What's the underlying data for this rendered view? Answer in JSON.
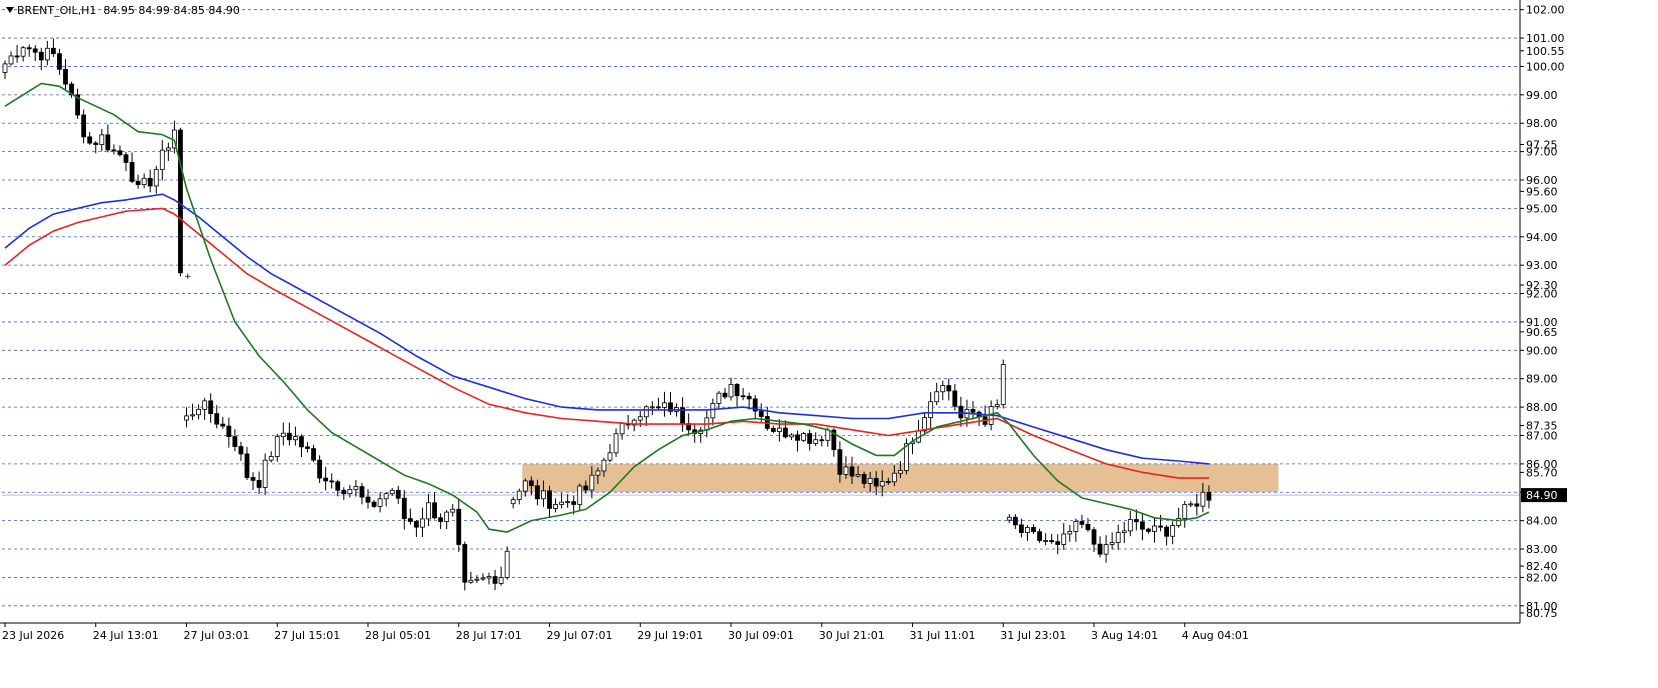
{
  "header": {
    "symbol": "BRENT_OIL,H1",
    "ohlc": "84.95 84.99 84.85 84.90"
  },
  "colors": {
    "background": "#ffffff",
    "grid": "#3b5fc6",
    "candle_up_fill": "#ffffff",
    "candle_down_fill": "#000000",
    "ma_fast": "#1e7a1e",
    "ma_mid": "#e8231c",
    "ma_slow": "#1a2fe0",
    "zone": "#e0b583",
    "current_price_box": "#000000"
  },
  "chart_data": {
    "type": "candlestick",
    "ylim": [
      80.5,
      102.2
    ],
    "grid": true,
    "y_ticks": [
      {
        "value": 102.0,
        "label": "102.00"
      },
      {
        "value": 101.0,
        "label": "101.00"
      },
      {
        "value": 100.55,
        "label": "100.55"
      },
      {
        "value": 100.0,
        "label": "100.00"
      },
      {
        "value": 99.0,
        "label": "99.00"
      },
      {
        "value": 98.0,
        "label": "98.00"
      },
      {
        "value": 97.25,
        "label": "97.25"
      },
      {
        "value": 97.0,
        "label": "97.00"
      },
      {
        "value": 96.0,
        "label": "96.00"
      },
      {
        "value": 95.6,
        "label": "95.60"
      },
      {
        "value": 95.0,
        "label": "95.00"
      },
      {
        "value": 94.0,
        "label": "94.00"
      },
      {
        "value": 93.0,
        "label": "93.00"
      },
      {
        "value": 92.3,
        "label": "92.30"
      },
      {
        "value": 92.0,
        "label": "92.00"
      },
      {
        "value": 91.0,
        "label": "91.00"
      },
      {
        "value": 90.65,
        "label": "90.65"
      },
      {
        "value": 90.0,
        "label": "90.00"
      },
      {
        "value": 89.0,
        "label": "89.00"
      },
      {
        "value": 88.0,
        "label": "88.00"
      },
      {
        "value": 87.35,
        "label": "87.35"
      },
      {
        "value": 87.0,
        "label": "87.00"
      },
      {
        "value": 86.0,
        "label": "86.00"
      },
      {
        "value": 85.7,
        "label": "85.70"
      },
      {
        "value": 85.0,
        "label": "85.00"
      },
      {
        "value": 84.0,
        "label": "84.00"
      },
      {
        "value": 83.0,
        "label": "83.00"
      },
      {
        "value": 82.4,
        "label": "82.40"
      },
      {
        "value": 82.0,
        "label": "82.00"
      },
      {
        "value": 81.0,
        "label": "81.00"
      },
      {
        "value": 80.75,
        "label": "80.75"
      }
    ],
    "grid_levels": [
      102,
      101,
      100,
      99,
      98,
      97,
      96,
      95,
      94,
      93,
      92,
      91,
      90,
      89,
      88,
      87,
      86,
      85,
      84,
      83,
      82,
      81
    ],
    "current_price": {
      "value": 84.9,
      "label": "84.90"
    },
    "x_labels": [
      {
        "index": 0,
        "label": "23 Jul 2026"
      },
      {
        "index": 15,
        "label": "24 Jul 13:01"
      },
      {
        "index": 30,
        "label": "27 Jul 03:01"
      },
      {
        "index": 45,
        "label": "27 Jul 15:01"
      },
      {
        "index": 60,
        "label": "28 Jul 05:01"
      },
      {
        "index": 75,
        "label": "28 Jul 17:01"
      },
      {
        "index": 90,
        "label": "29 Jul 07:01"
      },
      {
        "index": 105,
        "label": "29 Jul 19:01"
      },
      {
        "index": 120,
        "label": "30 Jul 09:01"
      },
      {
        "index": 135,
        "label": "30 Jul 21:01"
      },
      {
        "index": 150,
        "label": "31 Jul 11:01"
      },
      {
        "index": 165,
        "label": "31 Jul 23:01"
      },
      {
        "index": 180,
        "label": "3 Aug 14:01"
      },
      {
        "index": 195,
        "label": "4 Aug 04:01"
      }
    ],
    "anchors": [
      [
        0,
        100.1
      ],
      [
        3,
        100.8
      ],
      [
        5,
        100.5
      ],
      [
        8,
        100.4
      ],
      [
        10,
        99.5
      ],
      [
        12,
        98.2
      ],
      [
        14,
        97.3
      ],
      [
        16,
        97.5
      ],
      [
        18,
        97.0
      ],
      [
        20,
        96.8
      ],
      [
        22,
        95.6
      ],
      [
        24,
        96.0
      ],
      [
        26,
        96.8
      ],
      [
        28,
        97.8
      ],
      [
        30,
        87.6
      ],
      [
        32,
        88.1
      ],
      [
        34,
        87.8
      ],
      [
        36,
        87.3
      ],
      [
        38,
        86.8
      ],
      [
        40,
        85.6
      ],
      [
        42,
        85.4
      ],
      [
        44,
        86.4
      ],
      [
        46,
        87.1
      ],
      [
        48,
        86.9
      ],
      [
        50,
        86.4
      ],
      [
        52,
        85.7
      ],
      [
        54,
        85.4
      ],
      [
        56,
        85.2
      ],
      [
        58,
        85.1
      ],
      [
        60,
        84.4
      ],
      [
        62,
        84.8
      ],
      [
        64,
        85.1
      ],
      [
        66,
        84.1
      ],
      [
        68,
        83.9
      ],
      [
        70,
        84.5
      ],
      [
        72,
        84.1
      ],
      [
        74,
        84.2
      ],
      [
        76,
        81.6
      ],
      [
        78,
        81.8
      ],
      [
        80,
        82.0
      ],
      [
        82,
        82.1
      ],
      [
        83,
        83.0
      ],
      [
        84,
        84.9
      ],
      [
        86,
        85.3
      ],
      [
        88,
        84.9
      ],
      [
        90,
        84.7
      ],
      [
        92,
        84.6
      ],
      [
        94,
        84.8
      ],
      [
        96,
        85.1
      ],
      [
        98,
        85.7
      ],
      [
        100,
        86.6
      ],
      [
        102,
        87.2
      ],
      [
        104,
        87.8
      ],
      [
        106,
        87.9
      ],
      [
        108,
        87.9
      ],
      [
        110,
        88.0
      ],
      [
        112,
        87.6
      ],
      [
        114,
        87.3
      ],
      [
        116,
        87.6
      ],
      [
        118,
        88.3
      ],
      [
        120,
        88.8
      ],
      [
        122,
        88.5
      ],
      [
        124,
        88.1
      ],
      [
        126,
        87.4
      ],
      [
        128,
        87.1
      ],
      [
        130,
        87.2
      ],
      [
        132,
        87.0
      ],
      [
        134,
        86.9
      ],
      [
        136,
        87.2
      ],
      [
        138,
        85.9
      ],
      [
        140,
        85.6
      ],
      [
        142,
        85.4
      ],
      [
        144,
        85.1
      ],
      [
        146,
        85.5
      ],
      [
        148,
        86.0
      ],
      [
        150,
        87.0
      ],
      [
        152,
        87.8
      ],
      [
        154,
        88.8
      ],
      [
        156,
        88.6
      ],
      [
        158,
        87.6
      ],
      [
        160,
        87.8
      ],
      [
        162,
        87.6
      ],
      [
        164,
        88.0
      ],
      [
        165,
        89.5
      ],
      [
        166,
        83.9
      ],
      [
        168,
        83.6
      ],
      [
        170,
        83.4
      ],
      [
        172,
        83.3
      ],
      [
        174,
        83.0
      ],
      [
        176,
        83.6
      ],
      [
        178,
        83.8
      ],
      [
        180,
        83.2
      ],
      [
        182,
        82.9
      ],
      [
        184,
        83.5
      ],
      [
        186,
        83.9
      ],
      [
        188,
        83.7
      ],
      [
        190,
        83.6
      ],
      [
        192,
        83.7
      ],
      [
        194,
        84.1
      ],
      [
        196,
        84.5
      ],
      [
        198,
        84.9
      ],
      [
        199,
        84.9
      ]
    ],
    "ma_fast_points": [
      [
        0,
        98.6
      ],
      [
        6,
        99.4
      ],
      [
        9,
        99.3
      ],
      [
        12,
        98.9
      ],
      [
        18,
        98.3
      ],
      [
        22,
        97.7
      ],
      [
        26,
        97.6
      ],
      [
        28,
        97.4
      ],
      [
        30,
        95.7
      ],
      [
        34,
        93.2
      ],
      [
        38,
        91.0
      ],
      [
        42,
        89.8
      ],
      [
        46,
        88.9
      ],
      [
        50,
        87.9
      ],
      [
        54,
        87.1
      ],
      [
        58,
        86.6
      ],
      [
        62,
        86.1
      ],
      [
        66,
        85.6
      ],
      [
        70,
        85.3
      ],
      [
        74,
        84.9
      ],
      [
        78,
        84.3
      ],
      [
        80,
        83.7
      ],
      [
        83,
        83.6
      ],
      [
        87,
        84.0
      ],
      [
        92,
        84.2
      ],
      [
        96,
        84.4
      ],
      [
        100,
        85.0
      ],
      [
        104,
        85.9
      ],
      [
        108,
        86.5
      ],
      [
        112,
        87.0
      ],
      [
        116,
        87.2
      ],
      [
        120,
        87.5
      ],
      [
        124,
        87.6
      ],
      [
        128,
        87.5
      ],
      [
        132,
        87.4
      ],
      [
        136,
        87.2
      ],
      [
        140,
        86.7
      ],
      [
        144,
        86.3
      ],
      [
        147,
        86.3
      ],
      [
        150,
        86.8
      ],
      [
        154,
        87.3
      ],
      [
        158,
        87.5
      ],
      [
        162,
        87.7
      ],
      [
        164,
        87.8
      ],
      [
        166,
        87.4
      ],
      [
        170,
        86.3
      ],
      [
        174,
        85.4
      ],
      [
        178,
        84.8
      ],
      [
        182,
        84.6
      ],
      [
        186,
        84.4
      ],
      [
        190,
        84.1
      ],
      [
        194,
        84.0
      ],
      [
        197,
        84.1
      ],
      [
        199,
        84.3
      ]
    ],
    "ma_mid_points": [
      [
        0,
        93.0
      ],
      [
        4,
        93.7
      ],
      [
        8,
        94.2
      ],
      [
        12,
        94.5
      ],
      [
        16,
        94.7
      ],
      [
        20,
        94.9
      ],
      [
        26,
        95.0
      ],
      [
        28,
        94.8
      ],
      [
        32,
        94.1
      ],
      [
        36,
        93.4
      ],
      [
        40,
        92.7
      ],
      [
        44,
        92.2
      ],
      [
        50,
        91.5
      ],
      [
        56,
        90.8
      ],
      [
        62,
        90.1
      ],
      [
        68,
        89.4
      ],
      [
        74,
        88.7
      ],
      [
        80,
        88.1
      ],
      [
        86,
        87.8
      ],
      [
        92,
        87.6
      ],
      [
        98,
        87.5
      ],
      [
        104,
        87.4
      ],
      [
        110,
        87.4
      ],
      [
        116,
        87.4
      ],
      [
        122,
        87.5
      ],
      [
        128,
        87.4
      ],
      [
        134,
        87.4
      ],
      [
        140,
        87.2
      ],
      [
        146,
        87.0
      ],
      [
        152,
        87.2
      ],
      [
        158,
        87.4
      ],
      [
        164,
        87.6
      ],
      [
        170,
        87.0
      ],
      [
        176,
        86.5
      ],
      [
        182,
        86.0
      ],
      [
        188,
        85.7
      ],
      [
        194,
        85.5
      ],
      [
        199,
        85.5
      ]
    ],
    "ma_slow_points": [
      [
        0,
        93.6
      ],
      [
        4,
        94.3
      ],
      [
        8,
        94.8
      ],
      [
        12,
        95.0
      ],
      [
        16,
        95.2
      ],
      [
        20,
        95.3
      ],
      [
        26,
        95.5
      ],
      [
        28,
        95.3
      ],
      [
        32,
        94.7
      ],
      [
        36,
        94.0
      ],
      [
        40,
        93.3
      ],
      [
        44,
        92.7
      ],
      [
        50,
        92.0
      ],
      [
        56,
        91.3
      ],
      [
        62,
        90.6
      ],
      [
        68,
        89.8
      ],
      [
        74,
        89.1
      ],
      [
        80,
        88.7
      ],
      [
        86,
        88.3
      ],
      [
        92,
        88.0
      ],
      [
        98,
        87.9
      ],
      [
        104,
        87.9
      ],
      [
        110,
        87.9
      ],
      [
        116,
        87.9
      ],
      [
        122,
        88.0
      ],
      [
        128,
        87.8
      ],
      [
        134,
        87.7
      ],
      [
        140,
        87.6
      ],
      [
        146,
        87.6
      ],
      [
        152,
        87.8
      ],
      [
        158,
        87.8
      ],
      [
        164,
        87.7
      ],
      [
        170,
        87.3
      ],
      [
        176,
        86.9
      ],
      [
        182,
        86.5
      ],
      [
        188,
        86.2
      ],
      [
        194,
        86.1
      ],
      [
        199,
        86.0
      ]
    ],
    "zone": {
      "x_start": 86,
      "x_end": 210,
      "y_low": 85.0,
      "y_high": 86.0
    },
    "candle_count": 200
  }
}
